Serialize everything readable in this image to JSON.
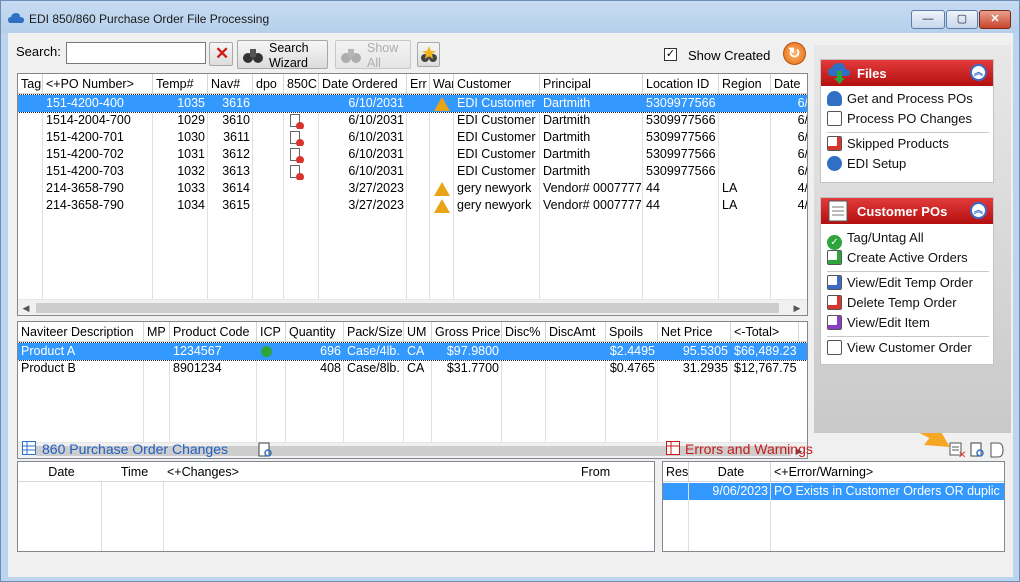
{
  "window": {
    "title": "EDI 850/860 Purchase Order File Processing",
    "min": "—",
    "max": "▢",
    "close": "✕"
  },
  "toolbar": {
    "search_label": "Search:",
    "search_value": "",
    "clear_icon": "x-icon",
    "search_wizard_label_1": "Search",
    "search_wizard_label_2": "Wizard",
    "show_all_label_1": "Show",
    "show_all_label_2": "All",
    "show_created_label": "Show Created",
    "show_created_checked": true
  },
  "orders": {
    "columns": [
      "Tag",
      "<+PO Number>",
      "Temp#",
      "Nav#",
      "dpo",
      "850C",
      "Date Ordered",
      "Err",
      "War",
      "Customer",
      "Principal",
      "Location ID",
      "Region",
      "Date"
    ],
    "rows": [
      {
        "po": "151-4200-400",
        "temp": "1035",
        "nav": "3616",
        "doc": false,
        "date": "6/10/2031",
        "warn": true,
        "customer": "EDI Customer",
        "principal": "Dartmith",
        "location": "5309977566",
        "region": "",
        "date2": "6/",
        "selected": true
      },
      {
        "po": "1514-2004-700",
        "temp": "1029",
        "nav": "3610",
        "doc": true,
        "date": "6/10/2031",
        "warn": false,
        "customer": "EDI Customer",
        "principal": "Dartmith",
        "location": "5309977566",
        "region": "",
        "date2": "6/"
      },
      {
        "po": "151-4200-701",
        "temp": "1030",
        "nav": "3611",
        "doc": true,
        "date": "6/10/2031",
        "warn": false,
        "customer": "EDI Customer",
        "principal": "Dartmith",
        "location": "5309977566",
        "region": "",
        "date2": "6/"
      },
      {
        "po": "151-4200-702",
        "temp": "1031",
        "nav": "3612",
        "doc": true,
        "date": "6/10/2031",
        "warn": false,
        "customer": "EDI Customer",
        "principal": "Dartmith",
        "location": "5309977566",
        "region": "",
        "date2": "6/"
      },
      {
        "po": "151-4200-703",
        "temp": "1032",
        "nav": "3613",
        "doc": true,
        "date": "6/10/2031",
        "warn": false,
        "customer": "EDI Customer",
        "principal": "Dartmith",
        "location": "5309977566",
        "region": "",
        "date2": "6/"
      },
      {
        "po": "214-3658-790",
        "temp": "1033",
        "nav": "3614",
        "doc": false,
        "date": "3/27/2023",
        "warn": true,
        "customer": "gery newyork",
        "principal": "Vendor# 0007777",
        "location": "44",
        "region": "LA",
        "date2": "4/"
      },
      {
        "po": "214-3658-790",
        "temp": "1034",
        "nav": "3615",
        "doc": false,
        "date": "3/27/2023",
        "warn": true,
        "customer": "gery newyork",
        "principal": "Vendor# 0007777",
        "location": "44",
        "region": "LA",
        "date2": "4/"
      }
    ]
  },
  "items": {
    "columns": [
      "Naviteer Description",
      "MP",
      "Product Code",
      "ICP",
      "Quantity",
      "Pack/Size",
      "UM",
      "Gross Price",
      "Disc%",
      "DiscAmt",
      "Spoils",
      "Net Price",
      "<-Total>"
    ],
    "rows": [
      {
        "desc": "Product A",
        "code": "1234567",
        "icp": true,
        "qty": "696",
        "pack": "Case/4lb.",
        "um": "CA",
        "gross": "$97.9800",
        "spoils": "$2.4495",
        "net": "95.5305",
        "total": "$66,489.23",
        "selected": true
      },
      {
        "desc": "Product B",
        "code": "8901234",
        "icp": false,
        "qty": "408",
        "pack": "Case/8lb.",
        "um": "CA",
        "gross": "$31.7700",
        "spoils": "$0.4765",
        "net": "31.2935",
        "total": "$12,767.75"
      }
    ]
  },
  "changes": {
    "title": "860 Purchase Order Changes",
    "columns": [
      "Date",
      "Time",
      "<+Changes>",
      "From"
    ]
  },
  "errors": {
    "title": "Errors and Warnings",
    "columns": [
      "Res",
      "Date",
      "<+Error/Warning>"
    ],
    "rows": [
      {
        "res": "",
        "date": "9/06/2023",
        "msg": "PO Exists in Customer Orders OR duplic"
      }
    ]
  },
  "files_panel": {
    "title": "Files",
    "items": [
      "Get and Process POs",
      "Process PO Changes",
      "Skipped Products",
      "EDI Setup"
    ]
  },
  "customer_panel": {
    "title": "Customer POs",
    "items": [
      "Tag/Untag All",
      "Create Active Orders",
      "View/Edit Temp Order",
      "Delete Temp Order",
      "View/Edit Item",
      "View Customer Order"
    ]
  },
  "colors": {
    "selection": "#3399ff",
    "panel_header": "#c81a1a",
    "link": "#1f5fbf",
    "arrow": "#f5a623"
  }
}
